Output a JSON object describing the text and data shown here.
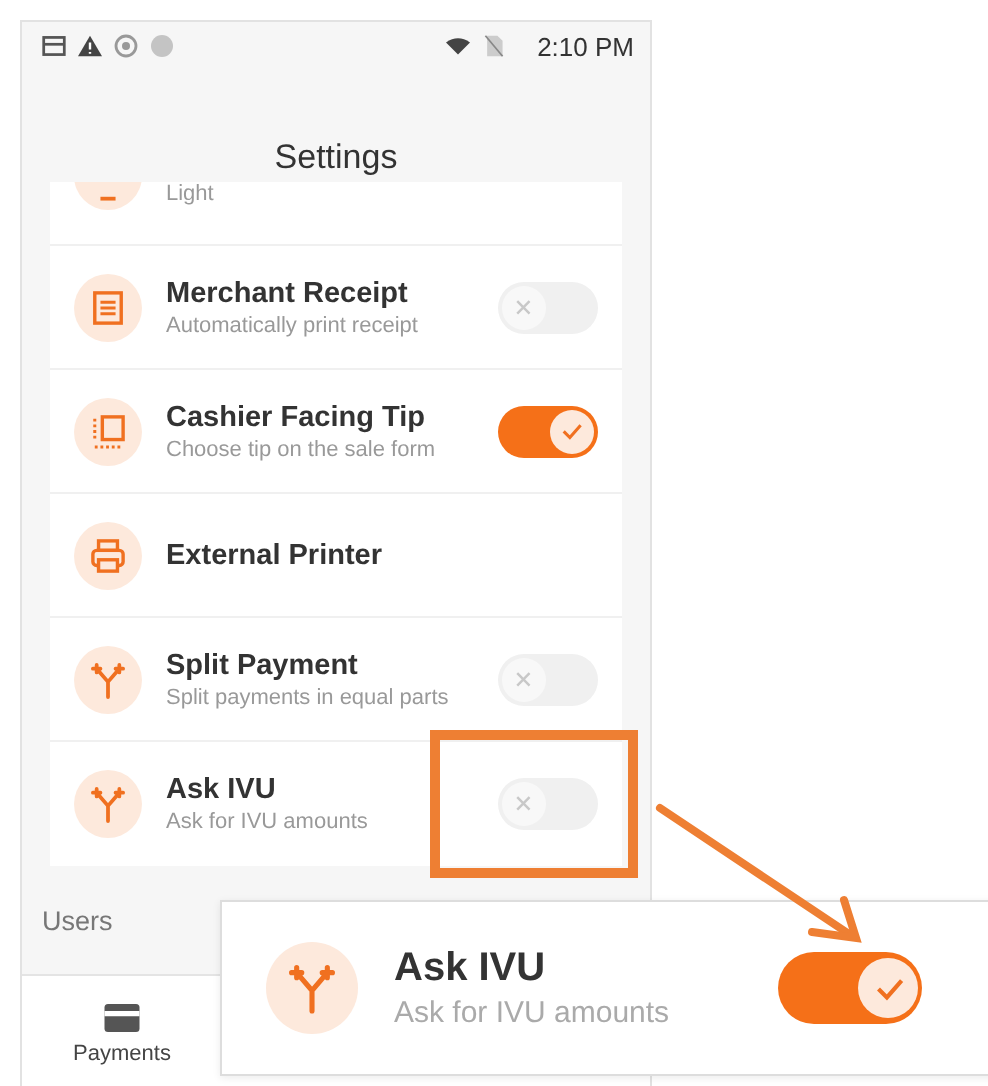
{
  "status_bar": {
    "time": "2:10 PM"
  },
  "header": {
    "title": "Settings"
  },
  "settings": [
    {
      "kind": "partial",
      "subtitle": "Light"
    },
    {
      "kind": "toggle",
      "title": "Merchant Receipt",
      "subtitle": "Automatically print receipt",
      "on": false
    },
    {
      "kind": "toggle",
      "title": "Cashier Facing Tip",
      "subtitle": "Choose tip on the sale form",
      "on": true
    },
    {
      "kind": "link",
      "title": "External Printer"
    },
    {
      "kind": "toggle",
      "title": "Split Payment",
      "subtitle": "Split payments in equal parts",
      "on": false
    },
    {
      "kind": "toggle",
      "title": "Ask IVU",
      "subtitle": "Ask for IVU amounts",
      "on": false
    }
  ],
  "section": {
    "title": "Users"
  },
  "bottom_nav": [
    {
      "label": "Payments"
    }
  ],
  "callout": {
    "title": "Ask IVU",
    "subtitle": "Ask for IVU amounts",
    "on": true
  }
}
